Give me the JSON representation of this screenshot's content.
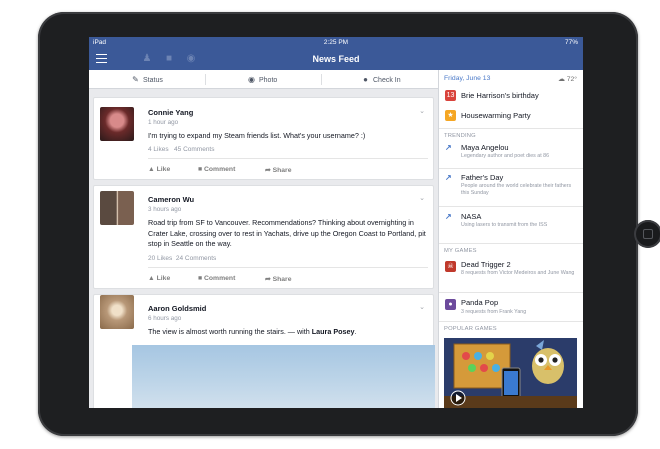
{
  "statusbar": {
    "carrier": "iPad",
    "time": "2:25 PM",
    "battery": "77%"
  },
  "navbar": {
    "title": "News Feed"
  },
  "composer": {
    "status": "Status",
    "photo": "Photo",
    "checkin": "Check In"
  },
  "posts": [
    {
      "name": "Connie Yang",
      "time": "1 hour ago",
      "text": "I'm trying to expand my Steam friends list. What's your username? :)",
      "likes": "4 Likes",
      "comments": "45 Comments"
    },
    {
      "name": "Cameron Wu",
      "time": "3 hours ago",
      "text": "Road trip from SF to Vancouver. Recommendations? Thinking about overnighting in Crater Lake, crossing over to rest in Yachats, drive up the Oregon Coast to Portland, pit stop in Seattle on the way.",
      "likes": "20 Likes",
      "comments": "24 Comments"
    },
    {
      "name": "Aaron Goldsmid",
      "time": "6 hours ago",
      "text_prefix": "The view is almost worth running the stairs. — with ",
      "text_tag": "Laura Posey",
      "text_suffix": "."
    }
  ],
  "post_actions": {
    "like": "Like",
    "comment": "Comment",
    "share": "Share"
  },
  "sidebar": {
    "date": "Friday, June 13",
    "weather": "72°",
    "events": [
      {
        "title": "Brie Harrison's birthday",
        "day": "13"
      },
      {
        "title": "Housewarming Party"
      }
    ],
    "trending_header": "TRENDING",
    "trending": [
      {
        "title": "Maya Angelou",
        "sub": "Legendary author and poet dies at 86"
      },
      {
        "title": "Father's Day",
        "sub": "People around the world celebrate their fathers this Sunday"
      },
      {
        "title": "NASA",
        "sub": "Using lasers to transmit from the ISS"
      }
    ],
    "games_header": "MY GAMES",
    "games": [
      {
        "title": "Dead Trigger 2",
        "sub": "8 requests from Victor Medeiros and June Wang"
      },
      {
        "title": "Panda Pop",
        "sub": "3 requests from Frank Yang"
      }
    ],
    "popular_header": "POPULAR GAMES"
  },
  "colors": {
    "brand": "#3b5998",
    "link": "#4a79c8",
    "bg": "#e9eaed"
  }
}
